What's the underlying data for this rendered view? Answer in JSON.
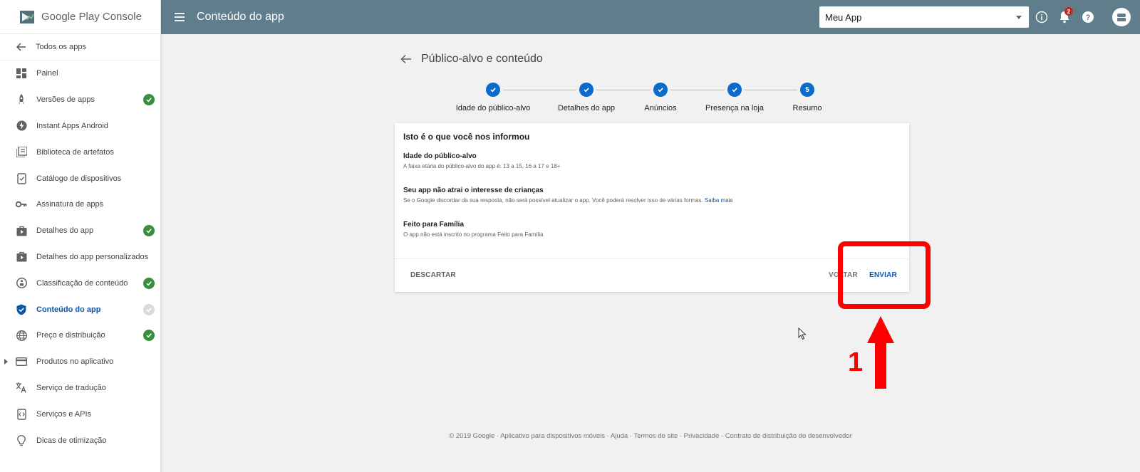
{
  "brand": {
    "name": "Google Play Console"
  },
  "sidebar": {
    "back_label": "Todos os apps",
    "items": [
      {
        "label": "Painel",
        "icon": "dashboard-icon",
        "status": "none"
      },
      {
        "label": "Versões de apps",
        "icon": "rocket-icon",
        "status": "ok"
      },
      {
        "label": "Instant Apps Android",
        "icon": "instant-bolt-icon",
        "status": "none"
      },
      {
        "label": "Biblioteca de artefatos",
        "icon": "library-icon",
        "status": "none"
      },
      {
        "label": "Catálogo de dispositivos",
        "icon": "device-catalog-icon",
        "status": "none"
      },
      {
        "label": "Assinatura de apps",
        "icon": "key-icon",
        "status": "none"
      },
      {
        "label": "Detalhes do app",
        "icon": "store-listing-icon",
        "status": "ok"
      },
      {
        "label": "Detalhes do app personalizados",
        "icon": "store-listing-icon",
        "status": "none"
      },
      {
        "label": "Classificação de conteúdo",
        "icon": "rating-icon",
        "status": "ok"
      },
      {
        "label": "Conteúdo do app",
        "icon": "shield-icon",
        "status": "pending",
        "active": true
      },
      {
        "label": "Preço e distribuição",
        "icon": "globe-icon",
        "status": "ok"
      },
      {
        "label": "Produtos no aplicativo",
        "icon": "credit-card-icon",
        "status": "none",
        "expandable": true
      },
      {
        "label": "Serviço de tradução",
        "icon": "translate-icon",
        "status": "none"
      },
      {
        "label": "Serviços e APIs",
        "icon": "api-icon",
        "status": "none"
      },
      {
        "label": "Dicas de otimização",
        "icon": "lightbulb-icon",
        "status": "none"
      }
    ]
  },
  "topbar": {
    "title": "Conteúdo do app",
    "app_select": "Meu App",
    "notification_count": "2"
  },
  "main": {
    "heading": "Público-alvo e conteúdo",
    "steps": [
      {
        "label": "Idade do público-alvo",
        "state": "done"
      },
      {
        "label": "Detalhes do app",
        "state": "done"
      },
      {
        "label": "Anúncios",
        "state": "done"
      },
      {
        "label": "Presença na loja",
        "state": "done"
      },
      {
        "label": "Resumo",
        "state": "current",
        "number": "5"
      }
    ],
    "card": {
      "title": "Isto é o que você nos informou",
      "sections": [
        {
          "heading": "Idade do público-alvo",
          "text": "A faixa etária do público-alvo do app é: 13 a 15, 16 a 17 e 18+"
        },
        {
          "heading": "Seu app não atrai o interesse de crianças",
          "text": "Se o Google discordar da sua resposta, não será possível atualizar o app. Você poderá resolver isso de várias formas.",
          "link": "Saiba mais"
        },
        {
          "heading": "Feito para Família",
          "text": "O app não está inscrito no programa Feito para Família"
        }
      ],
      "discard_label": "DESCARTAR",
      "back_label": "VOLTAR",
      "send_label": "ENVIAR"
    }
  },
  "annotation": {
    "number": "1",
    "color": "#ff0000"
  },
  "footer": {
    "text": "© 2019 Google · Aplicativo para dispositivos móveis · Ajuda · Termos do site · Privacidade · Contrato de distribuição do desenvolvedor"
  },
  "colors": {
    "topbar": "#607d8b",
    "accent": "#0b6bcb",
    "ok": "#388e3c"
  }
}
